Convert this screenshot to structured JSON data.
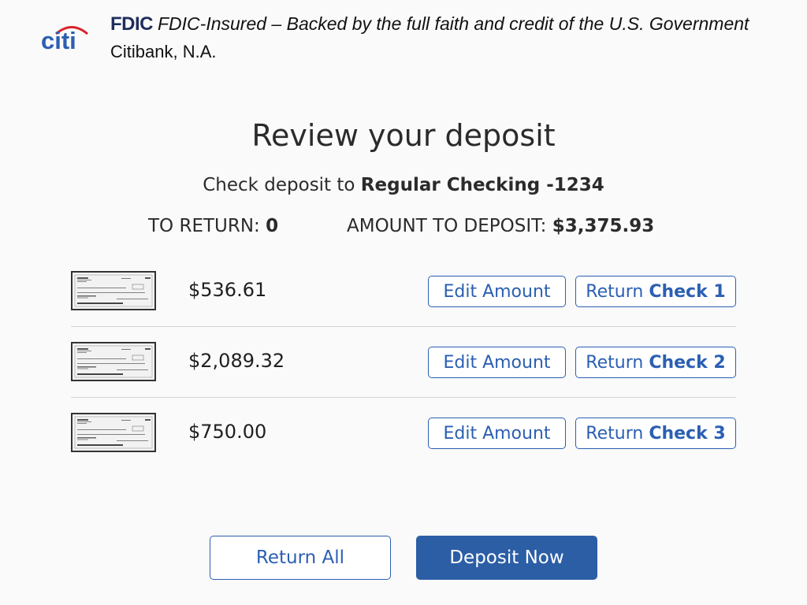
{
  "header": {
    "logo_text": "citi",
    "fdic_mark": "FDIC",
    "fdic_statement": "FDIC-Insured – Backed by the full faith and credit of the U.S. Government",
    "bank_name": "Citibank, N.A."
  },
  "review": {
    "title": "Review your deposit",
    "subtitle_prefix": "Check deposit to",
    "account": "Regular Checking -1234",
    "to_return_label": "TO RETURN:",
    "to_return_value": "0",
    "amount_label": "AMOUNT TO DEPOSIT:",
    "amount_value": "$3,375.93"
  },
  "checks": [
    {
      "amount": "$536.61",
      "edit_label": "Edit Amount",
      "return_label": "Return",
      "return_bold": "Check 1"
    },
    {
      "amount": "$2,089.32",
      "edit_label": "Edit Amount",
      "return_label": "Return",
      "return_bold": "Check 2"
    },
    {
      "amount": "$750.00",
      "edit_label": "Edit Amount",
      "return_label": "Return",
      "return_bold": "Check 3"
    }
  ],
  "footer": {
    "return_all_label": "Return All",
    "deposit_now_label": "Deposit Now"
  },
  "colors": {
    "brand_blue": "#2b5fb3",
    "primary_button": "#2c5ea6",
    "fdic_navy": "#1e2d5c",
    "citi_arc": "#d8232a"
  }
}
